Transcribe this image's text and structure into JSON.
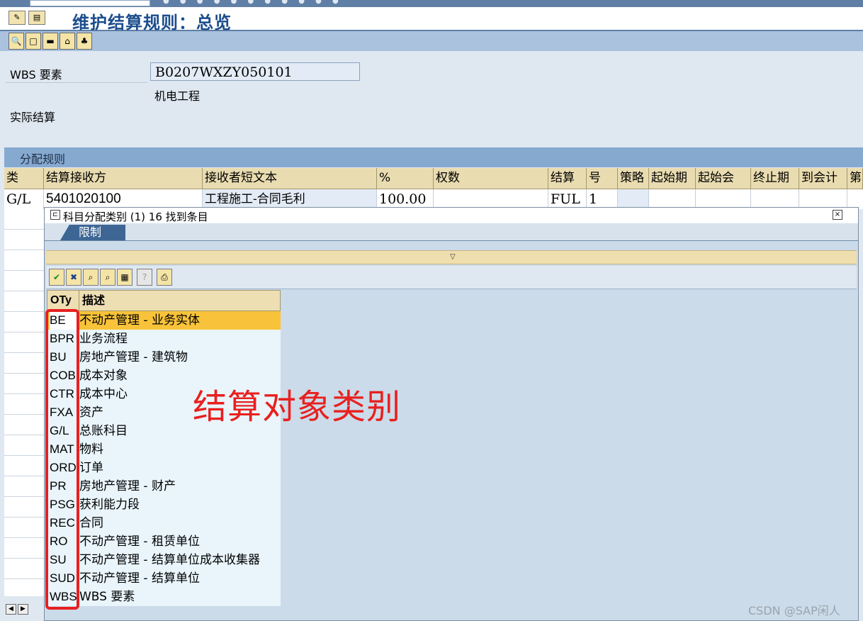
{
  "window": {
    "title": "维护结算规则：总览"
  },
  "header": {
    "wbs_label": "WBS 要素",
    "wbs_value": "B0207WXZY050101",
    "wbs_desc": "机电工程",
    "settlement_label": "实际结算"
  },
  "rules_table": {
    "section_title": "分配规则",
    "columns": [
      "类",
      "结算接收方",
      "接收者短文本",
      "%",
      "权数",
      "结算",
      "号",
      "策略",
      "起始期",
      "起始会",
      "终止期",
      "到会计",
      "第"
    ],
    "rows": [
      {
        "type": "G/L",
        "receiver": "5401020100",
        "short_text": "工程施工-合同毛利",
        "percent": "100.00",
        "weight": "",
        "settlement": "FUL",
        "no": "1"
      }
    ]
  },
  "popup": {
    "title": "科目分配类别 (1)   16 找到条目",
    "tab_label": "限制",
    "list_headers": {
      "code": "OTy",
      "desc": "描述"
    },
    "items": [
      {
        "code": "BE",
        "desc": "不动产管理 - 业务实体",
        "selected": true
      },
      {
        "code": "BPR",
        "desc": "业务流程"
      },
      {
        "code": "BU",
        "desc": "房地产管理 - 建筑物"
      },
      {
        "code": "COB",
        "desc": "成本对象"
      },
      {
        "code": "CTR",
        "desc": "成本中心"
      },
      {
        "code": "FXA",
        "desc": "资产"
      },
      {
        "code": "G/L",
        "desc": "总账科目"
      },
      {
        "code": "MAT",
        "desc": "物料"
      },
      {
        "code": "ORD",
        "desc": "订单"
      },
      {
        "code": "PR",
        "desc": "房地产管理 - 财产"
      },
      {
        "code": "PSG",
        "desc": "获利能力段"
      },
      {
        "code": "REC",
        "desc": "合同"
      },
      {
        "code": "RO",
        "desc": "不动产管理 - 租赁单位"
      },
      {
        "code": "SU",
        "desc": "不动产管理 - 结算单位成本收集器"
      },
      {
        "code": "SUD",
        "desc": "不动产管理 - 结算单位"
      },
      {
        "code": "WBS",
        "desc": "WBS 要素"
      }
    ]
  },
  "annotation": {
    "text": "结算对象类别",
    "color": "#e8201f"
  },
  "watermark": "CSDN @SAP闲人",
  "colors": {
    "title_blue": "#1b4d8c",
    "toolbar_blue": "#aac2de",
    "selected_row": "#f8c33a",
    "header_tan": "#e9dcb0"
  }
}
